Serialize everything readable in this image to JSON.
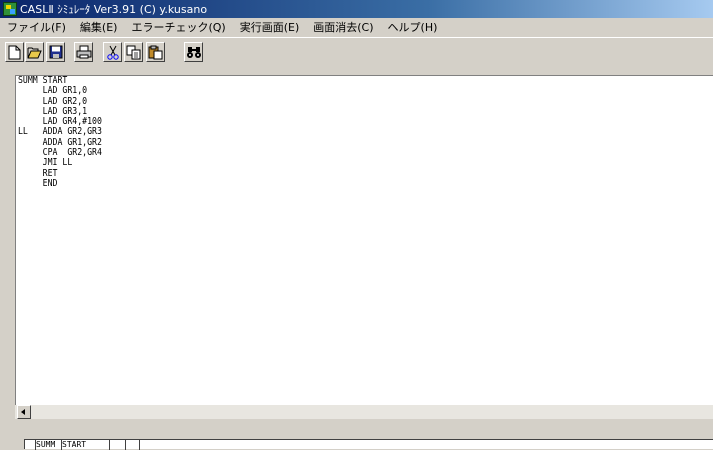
{
  "window": {
    "title": "CASLⅡ ｼﾐｭﾚｰﾀ  Ver3.91  (C) y.kusano"
  },
  "menu": [
    {
      "label": "ファイル(F)"
    },
    {
      "label": "編集(E)"
    },
    {
      "label": "エラーチェック(Q)"
    },
    {
      "label": "実行画面(E)"
    },
    {
      "label": "画面消去(C)"
    },
    {
      "label": "ヘルプ(H)"
    }
  ],
  "toolbar": {
    "buttons": [
      {
        "icon": "new-file-icon"
      },
      {
        "icon": "open-folder-icon"
      },
      {
        "icon": "save-disk-icon"
      },
      {
        "icon": "print-icon"
      },
      {
        "icon": "cut-scissors-icon"
      },
      {
        "icon": "copy-icon"
      },
      {
        "icon": "paste-icon"
      },
      {
        "icon": "find-binoculars-icon"
      }
    ]
  },
  "editor": {
    "lines": [
      "SUMM START",
      "     LAD GR1,0",
      "     LAD GR2,0",
      "     LAD GR3,1",
      "     LAD GR4,#100",
      "LL   ADDA GR2,GR3",
      "     ADDA GR1,GR2",
      "     CPA  GR2,GR4",
      "     JMI LL",
      "     RET",
      "     END"
    ]
  },
  "bottom_grid": {
    "cells": [
      "",
      "SUMM",
      "START",
      "",
      ""
    ]
  }
}
